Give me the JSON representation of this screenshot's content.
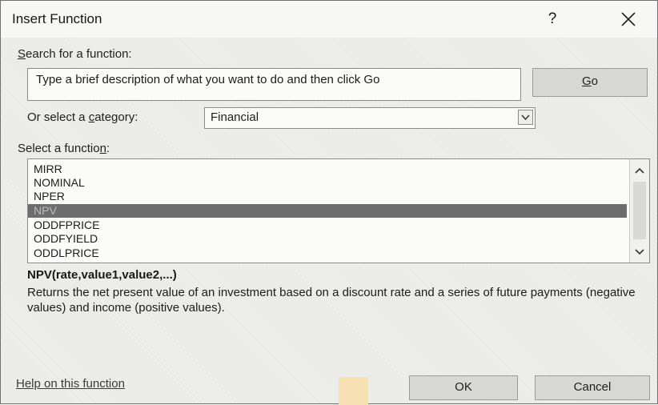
{
  "window": {
    "title": "Insert Function",
    "help_label": "?",
    "close_icon": "close-icon"
  },
  "search": {
    "label_prefix": "",
    "label_ul": "S",
    "label_rest": "earch for a function:",
    "text": "Type a brief description of what you want to do and then click Go",
    "go_ul": "G",
    "go_rest": "o"
  },
  "category": {
    "label_prefix": "Or select a ",
    "label_ul": "c",
    "label_rest": "ategory:",
    "value": "Financial"
  },
  "functions": {
    "label_prefix": "Select a functio",
    "label_ul": "n",
    "label_rest": ":",
    "items": [
      "MIRR",
      "NOMINAL",
      "NPER",
      "NPV",
      "ODDFPRICE",
      "ODDFYIELD",
      "ODDLPRICE"
    ],
    "selected": "NPV"
  },
  "details": {
    "syntax": "NPV(rate,value1,value2,...)",
    "description": "Returns the net present value of an investment based on a discount rate and a series of future payments (negative values) and income (positive values)."
  },
  "footer": {
    "help_link": "Help on this function",
    "ok": "OK",
    "cancel": "Cancel"
  }
}
